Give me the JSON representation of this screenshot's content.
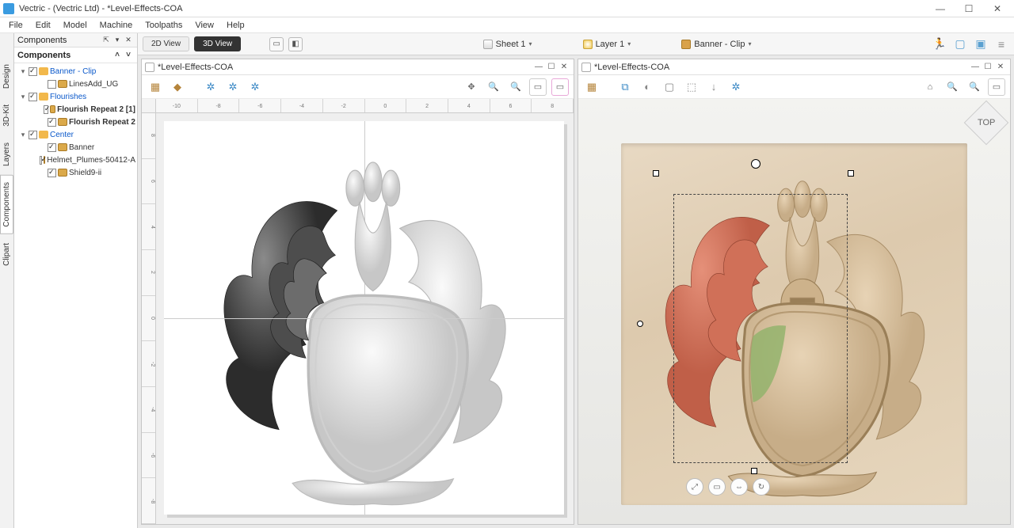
{
  "window": {
    "title": "Vectric - (Vectric Ltd) - *Level-Effects-COA",
    "min": "—",
    "max": "☐",
    "close": "✕"
  },
  "menu": [
    "File",
    "Edit",
    "Model",
    "Machine",
    "Toolpaths",
    "View",
    "Help"
  ],
  "sidetabs": [
    "Design",
    "3D-Kit",
    "Layers",
    "Components",
    "Clipart"
  ],
  "panel": {
    "title": "Components",
    "subtitle": "Components",
    "tree": [
      {
        "tgl": "▾",
        "chk": true,
        "icon": "folder",
        "label": "Banner - Clip",
        "link": true,
        "lvl": 0
      },
      {
        "tgl": "",
        "chk": false,
        "icon": "comp",
        "label": "LinesAdd_UG",
        "lvl": 2
      },
      {
        "tgl": "▾",
        "chk": true,
        "icon": "folder",
        "label": "Flourishes",
        "link": true,
        "lvl": 0
      },
      {
        "tgl": "",
        "chk": true,
        "icon": "comp",
        "label": "Flourish Repeat 2 [1]",
        "lvl": 2,
        "bold": true
      },
      {
        "tgl": "",
        "chk": true,
        "icon": "comp",
        "label": "Flourish Repeat 2",
        "lvl": 2,
        "bold": true
      },
      {
        "tgl": "▾",
        "chk": true,
        "icon": "folder",
        "label": "Center",
        "link": true,
        "lvl": 0
      },
      {
        "tgl": "",
        "chk": true,
        "icon": "comp",
        "label": "Banner",
        "lvl": 2
      },
      {
        "tgl": "",
        "chk": true,
        "icon": "comp",
        "label": "Helmet_Plumes-50412-A",
        "lvl": 2
      },
      {
        "tgl": "",
        "chk": true,
        "icon": "comp",
        "label": "Shield9-ii",
        "lvl": 2
      }
    ]
  },
  "topbar": {
    "view2d": "2D View",
    "view3d": "3D View",
    "sheet": "Sheet 1",
    "layer": "Layer 1",
    "level": "Banner - Clip"
  },
  "viewports": {
    "left": {
      "title": "*Level-Effects-COA"
    },
    "right": {
      "title": "*Level-Effects-COA",
      "topLabel": "TOP"
    }
  },
  "rulers": {
    "h": [
      "-10",
      "-8",
      "-6",
      "-4",
      "-2",
      "0",
      "2",
      "4",
      "6",
      "8"
    ],
    "v": [
      "8",
      "6",
      "4",
      "2",
      "0",
      "-2",
      "-4",
      "-6",
      "-8"
    ]
  }
}
